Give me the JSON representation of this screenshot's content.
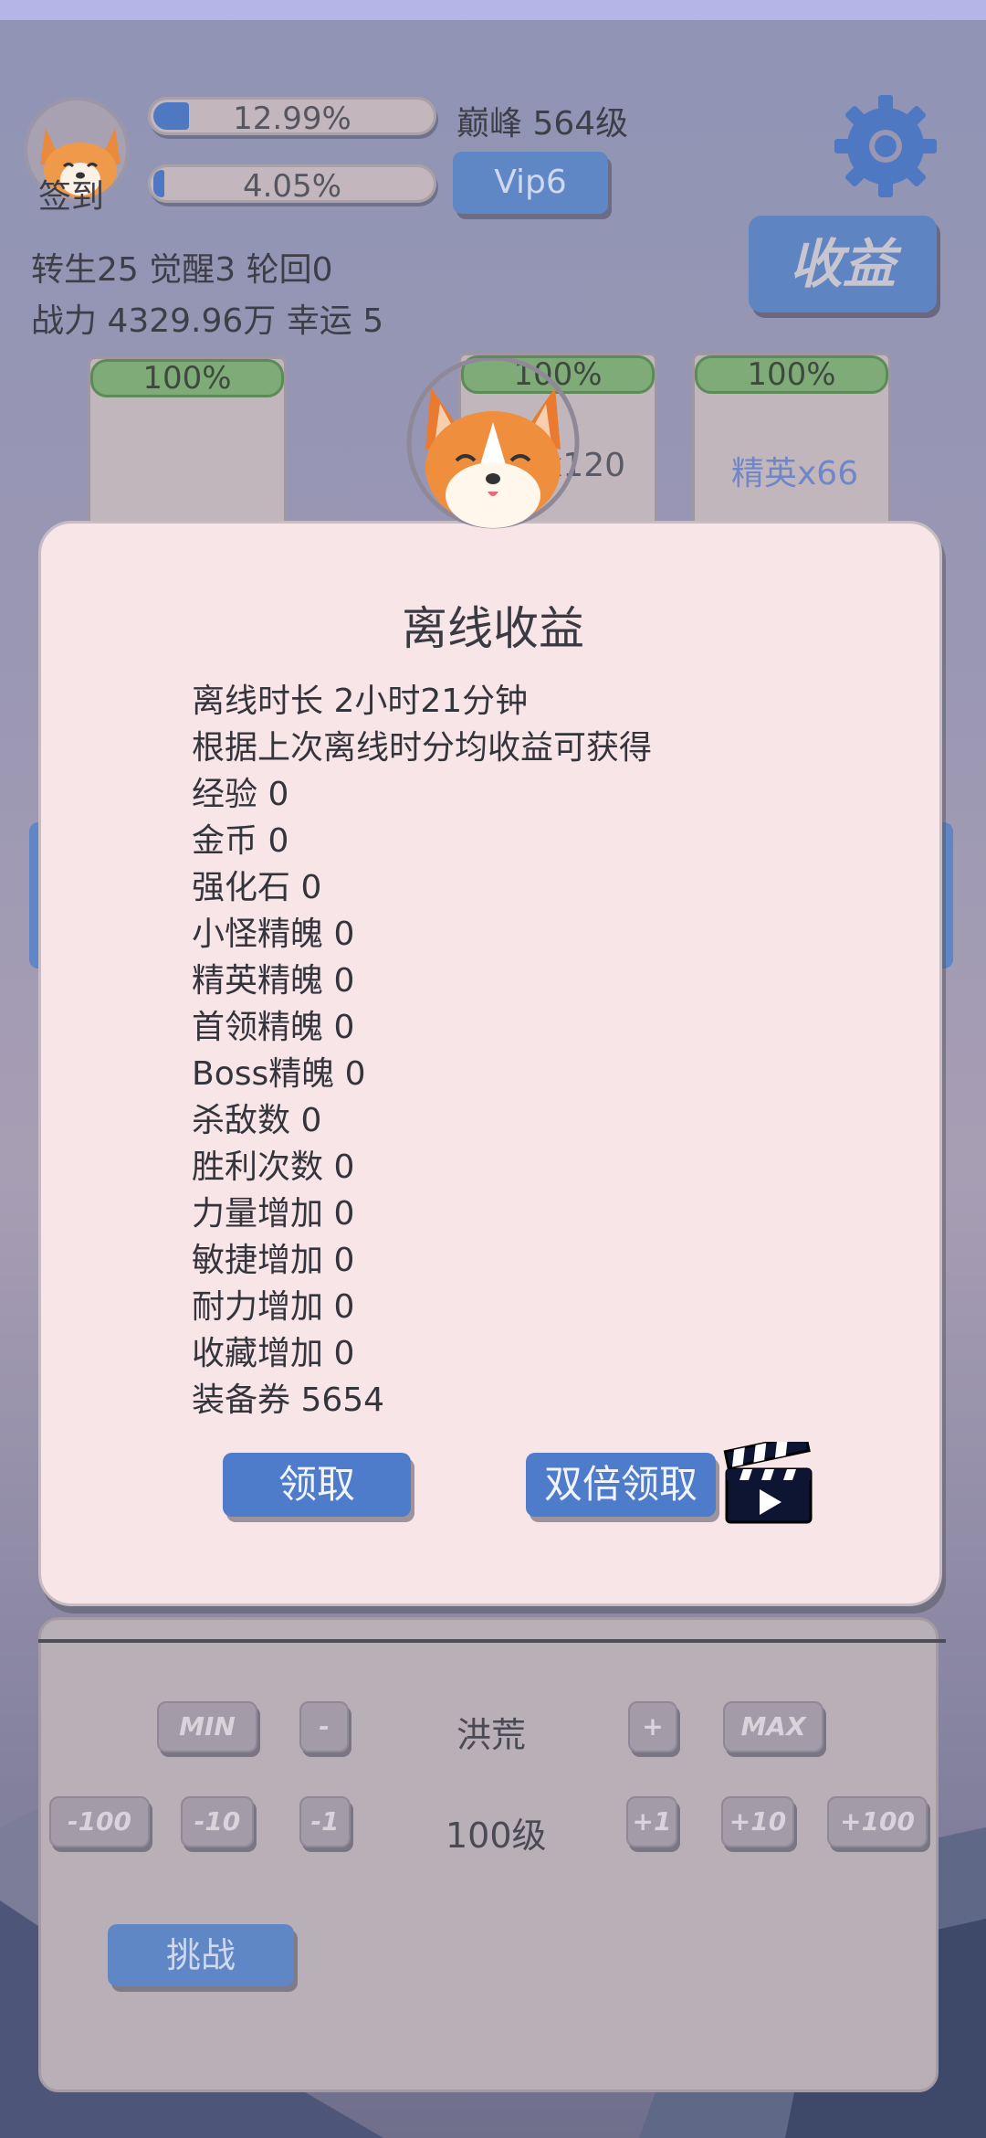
{
  "profile": {
    "avatar_label": "签到",
    "exp_percent": "12.99%",
    "exp_fill": 0.1299,
    "vip_percent": "4.05%",
    "vip_fill": 0.0405,
    "level_text": "巅峰 564级",
    "vip_label": "Vip6",
    "stats_line1": "转生25 觉醒3 轮回0",
    "stats_line2": "战力 4329.96万  幸运 5"
  },
  "header": {
    "earnings_button": "收益",
    "settings_icon": "gear-icon"
  },
  "cards": [
    {
      "percent": "100%",
      "label": ""
    },
    {
      "percent": "100%",
      "label": "x120"
    },
    {
      "percent": "100%",
      "label": "精英x66"
    }
  ],
  "controls": {
    "min_label": "MIN",
    "minus_label": "-",
    "zone_label": "洪荒",
    "plus_label": "+",
    "max_label": "MAX",
    "minus100": "-100",
    "minus10": "-10",
    "minus1": "-1",
    "level_label": "100级",
    "plus1": "+1",
    "plus10": "+10",
    "plus100": "+100",
    "challenge_label": "挑战"
  },
  "modal": {
    "title": "离线收益",
    "lines": [
      "离线时长 2小时21分钟",
      "根据上次离线时分均收益可获得",
      "经验   0",
      "金币   0",
      "强化石  0",
      "小怪精魄 0",
      "精英精魄 0",
      "首领精魄 0",
      "Boss精魄 0",
      "杀敌数  0",
      "胜利次数 0",
      "力量增加 0",
      "敏捷增加 0",
      "耐力增加 0",
      "收藏增加 0",
      "装备券  5654"
    ],
    "claim_button": "领取",
    "double_claim_button": "双倍领取",
    "video_icon": "clapperboard-play-icon"
  },
  "colors": {
    "accent_blue": "#4f7bcb",
    "card_green": "#7fab78",
    "modal_bg": "#f8e5e8"
  }
}
